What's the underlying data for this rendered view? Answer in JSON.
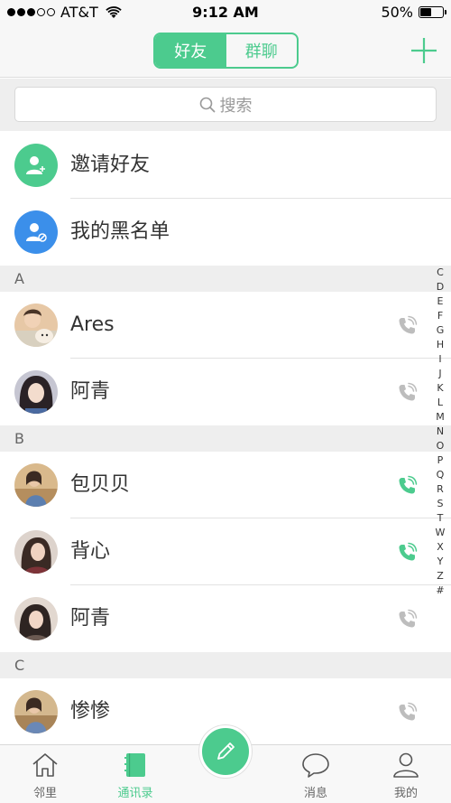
{
  "status_bar": {
    "carrier": "AT&T",
    "time": "9:12 AM",
    "battery": "50%",
    "battery_level": 0.5
  },
  "segments": [
    {
      "label": "好友",
      "selected": true
    },
    {
      "label": "群聊",
      "selected": false
    }
  ],
  "search": {
    "placeholder": "搜索"
  },
  "actions": [
    {
      "label": "邀请好友",
      "icon": "add-user-icon",
      "color": "#4ccb8e"
    },
    {
      "label": "我的黑名单",
      "icon": "blocked-user-icon",
      "color": "#3b8fea"
    }
  ],
  "sections": [
    {
      "letter": "A",
      "contacts": [
        {
          "name": "Ares",
          "call_active": false
        },
        {
          "name": "阿青",
          "call_active": false
        }
      ]
    },
    {
      "letter": "B",
      "contacts": [
        {
          "name": "包贝贝",
          "call_active": true
        },
        {
          "name": "背心",
          "call_active": true
        },
        {
          "name": "阿青",
          "call_active": false
        }
      ]
    },
    {
      "letter": "C",
      "contacts": [
        {
          "name": "惨惨",
          "call_active": false
        }
      ]
    }
  ],
  "index_letters": [
    "C",
    "D",
    "E",
    "F",
    "G",
    "H",
    "I",
    "J",
    "K",
    "L",
    "M",
    "N",
    "O",
    "P",
    "Q",
    "R",
    "S",
    "T",
    "W",
    "X",
    "Y",
    "Z",
    "#"
  ],
  "tabs": [
    {
      "label": "邻里",
      "icon": "home-icon",
      "active": false
    },
    {
      "label": "通讯录",
      "icon": "contacts-book-icon",
      "active": true
    },
    {
      "label": "消息",
      "icon": "message-bubble-icon",
      "active": false
    },
    {
      "label": "我的",
      "icon": "profile-icon",
      "active": false
    }
  ],
  "colors": {
    "accent": "#4ccb8e",
    "blue": "#3b8fea"
  }
}
